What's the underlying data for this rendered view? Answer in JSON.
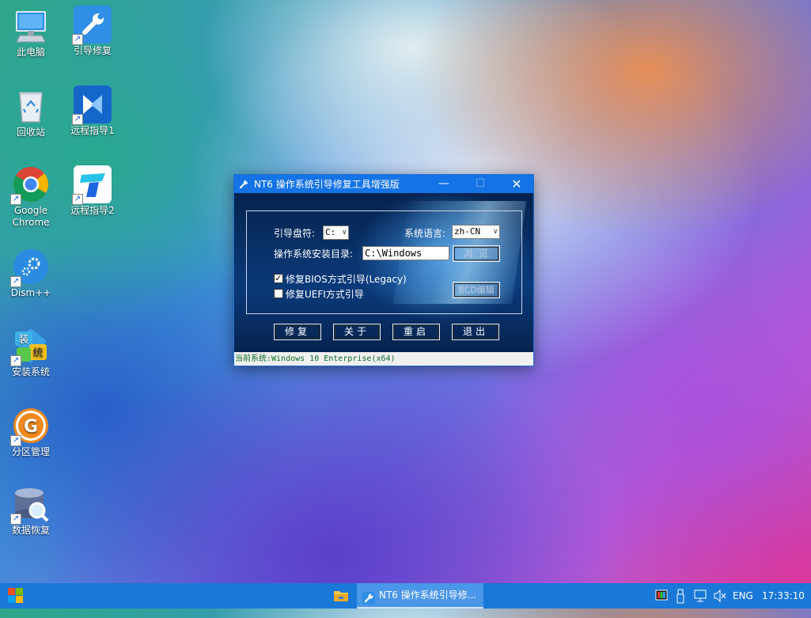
{
  "desktop": {
    "icons": [
      {
        "label": "此电脑",
        "icon": "computer-icon"
      },
      {
        "label": "引导修复",
        "icon": "wrench-icon"
      },
      {
        "label": "回收站",
        "icon": "recycle-bin-icon"
      },
      {
        "label": "远程指导1",
        "icon": "remote-assist-icon"
      },
      {
        "label": "Google Chrome",
        "icon": "chrome-icon"
      },
      {
        "label": "远程指导2",
        "icon": "todesk-icon"
      },
      {
        "label": "Dism++",
        "icon": "gears-icon"
      },
      {
        "label": "安装系统",
        "icon": "install-system-icon"
      },
      {
        "label": "分区管理",
        "icon": "partition-icon"
      },
      {
        "label": "数据恢复",
        "icon": "data-recovery-icon"
      }
    ]
  },
  "dialog": {
    "title": "NT6 操作系统引导修复工具增强版",
    "boot_drive_label": "引导盘符:",
    "boot_drive_value": "C:",
    "language_label": "系统语言:",
    "language_value": "zh-CN",
    "install_dir_label": "操作系统安装目录:",
    "install_dir_value": "C:\\Windows",
    "browse_label": "浏 览",
    "bios_label": "修复BIOS方式引导(Legacy)",
    "bios_checked": true,
    "uefi_label": "修复UEFI方式引导",
    "uefi_checked": false,
    "bcd_label": "BCD编辑",
    "buttons": {
      "repair": "修复",
      "about": "关于",
      "reboot": "重启",
      "exit": "退出"
    },
    "status": "当前系统:Windows 10 Enterprise(x64)"
  },
  "taskbar": {
    "active_window": "NT6 操作系统引导修...",
    "language": "ENG",
    "clock": "17:33:10"
  },
  "colors": {
    "taskbar": "#1a78d8",
    "titlebar": "#1473e6",
    "status_text": "#0a6b21"
  }
}
